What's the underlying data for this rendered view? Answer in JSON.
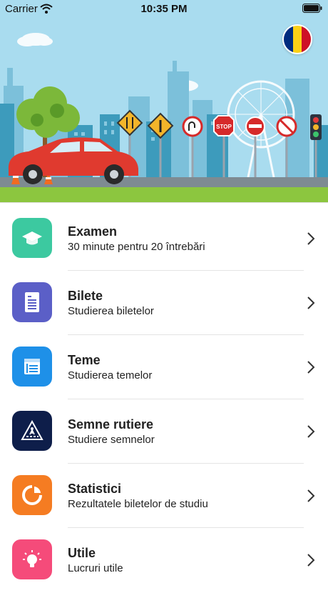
{
  "status_bar": {
    "carrier": "Carrier",
    "time": "10:35 PM"
  },
  "flag": {
    "name": "Romania",
    "colors": [
      "#002b7f",
      "#fcd116",
      "#ce1126"
    ]
  },
  "menu": {
    "items": [
      {
        "title": "Examen",
        "subtitle": "30 minute pentru 20 întrebări",
        "icon": "graduation-cap-icon",
        "color": "#3cc9a0"
      },
      {
        "title": "Bilete",
        "subtitle": "Studierea biletelor",
        "icon": "document-icon",
        "color": "#5b5fc7"
      },
      {
        "title": "Teme",
        "subtitle": "Studierea temelor",
        "icon": "book-icon",
        "color": "#1e90e8"
      },
      {
        "title": "Semne rutiere",
        "subtitle": "Studiere semnelor",
        "icon": "pedestrian-crossing-icon",
        "color": "#0e1e4a"
      },
      {
        "title": "Statistici",
        "subtitle": "Rezultatele biletelor de studiu",
        "icon": "pie-chart-icon",
        "color": "#f57c22"
      },
      {
        "title": "Utile",
        "subtitle": "Lucruri utile",
        "icon": "lightbulb-icon",
        "color": "#f54b7a"
      }
    ]
  }
}
